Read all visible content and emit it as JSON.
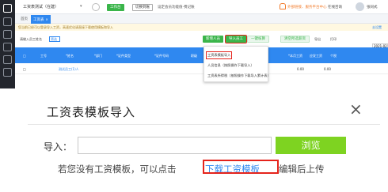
{
  "app": {
    "title": "工资表测试（在建）",
    "top_buttons": [
      "工作台",
      "切换到账"
    ],
    "top_hint": "设定会员功能值-费记账",
    "notice": "外部链接、服务平台中心",
    "help": "在线咨询",
    "user": "张同式"
  },
  "tabs": [
    {
      "label": "首页",
      "active": false
    },
    {
      "label": "工资表",
      "active": true
    }
  ],
  "banner": {
    "text": "您当前已经可以登录导入工资，高速优化请直接下载使用模板和导入",
    "link": "去设置"
  },
  "toolbar": {
    "search_text": "请输入员工姓名",
    "filter": "筛选",
    "new_button": "新增人员",
    "import_button": "导入员工",
    "calc_button": "一键核算",
    "clear_button": "清空所选薪资",
    "export": "导出",
    "print": "打印",
    "date": "2021-02"
  },
  "import_menu": [
    "工资表模板导入",
    "人员信息（按照操作下载导入）",
    "工资表所得税（按照操作下载导入累计表）"
  ],
  "grid": {
    "headers": [
      "工号",
      "*姓名",
      "*部门",
      "*证件类型",
      "*证件号码",
      "职级",
      "*本月工资",
      "应发工资",
      "个税"
    ],
    "rows": [
      {
        "name": "测试员工(1)人",
        "values": [
          "0.00",
          "0.00"
        ]
      }
    ]
  },
  "dialog": {
    "title": "工资表模板导入",
    "import_label": "导入：",
    "file_value": "",
    "browse_button": "浏览",
    "hint_prefix": "若您没有工资模板，可以点击",
    "hint_link": "下载工资模板",
    "hint_suffix": "编辑后上传"
  },
  "colors": {
    "accent_blue": "#2f88f0",
    "green": "#3ab54a",
    "browse_green": "#7ed321",
    "highlight_red": "#e5231b"
  }
}
